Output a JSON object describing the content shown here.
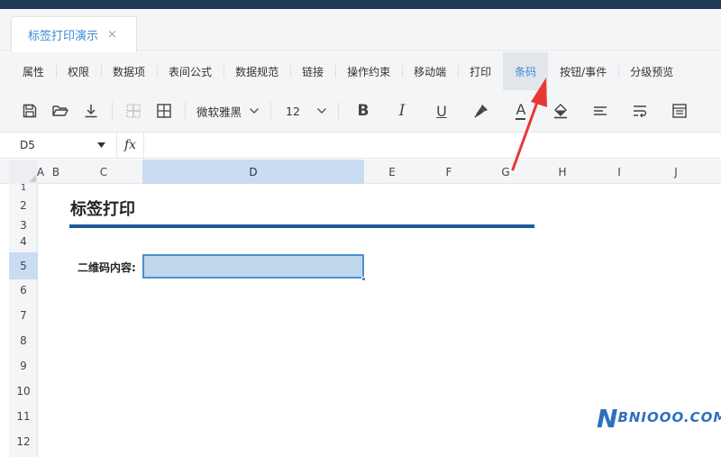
{
  "tab": {
    "label": "标签打印演示",
    "close": "×"
  },
  "menu": {
    "items": [
      "属性",
      "权限",
      "数据项",
      "表间公式",
      "数据规范",
      "链接",
      "操作约束",
      "移动端",
      "打印",
      "条码",
      "按钮/事件",
      "分级预览"
    ],
    "active_index": 9
  },
  "toolbar": {
    "font_family": "微软雅黑",
    "font_size": "12",
    "bold": "B",
    "italic": "I",
    "underline": "U",
    "font_color_letter": "A",
    "icons": [
      "save-icon",
      "folder-open-icon",
      "download-icon",
      "border-none-icon",
      "border-all-icon",
      "chevron-down-icon",
      "format-painter-icon",
      "fill-color-icon",
      "align-left-icon",
      "wrap-text-icon",
      "cell-format-icon"
    ]
  },
  "formula_bar": {
    "cell_ref": "D5",
    "fx": "fx",
    "value": ""
  },
  "columns": [
    "A",
    "B",
    "C",
    "D",
    "E",
    "F",
    "G",
    "H",
    "I",
    "J"
  ],
  "selected_column": "D",
  "rows": [
    "1",
    "2",
    "3",
    "4",
    "5",
    "6",
    "7",
    "8",
    "9",
    "10",
    "11",
    "12"
  ],
  "selected_row": "5",
  "sheet": {
    "title": "标签打印",
    "field_label": "二维码内容:",
    "active_cell_value": ""
  },
  "colors": {
    "accent": "#3a8ad8",
    "title_rule": "#1d5c96",
    "selection": "#c9dcf2",
    "arrow": "#e53935"
  },
  "watermark": {
    "n": "N",
    "rest": "BNIOOO.COM"
  }
}
